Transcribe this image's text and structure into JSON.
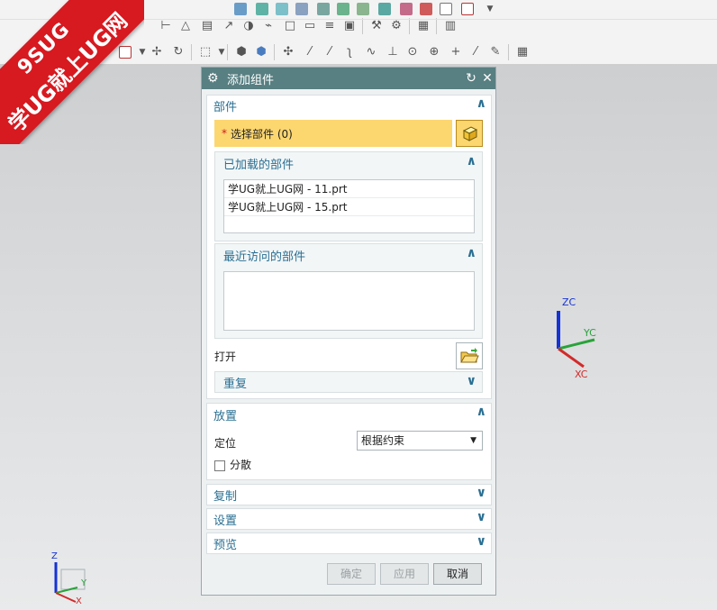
{
  "brand": {
    "line1": "9SUG",
    "line2": "学UG就上UG网"
  },
  "dialog": {
    "title": "添加组件",
    "part_section": {
      "heading": "部件",
      "select_label": "选择部件 (0)",
      "loaded_heading": "已加载的部件",
      "loaded_items": [
        "学UG就上UG网 - 11.prt",
        "学UG就上UG网 - 15.prt"
      ],
      "recent_heading": "最近访问的部件",
      "open_label": "打开",
      "repeat_heading": "重复"
    },
    "placement_section": {
      "heading": "放置",
      "position_label": "定位",
      "position_value": "根据约束",
      "scatter_label": "分散"
    },
    "copy_heading": "复制",
    "settings_heading": "设置",
    "preview_heading": "预览",
    "buttons": {
      "ok": "确定",
      "apply": "应用",
      "cancel": "取消"
    }
  },
  "triad_main": {
    "z": "ZC",
    "y": "YC",
    "x": "XC"
  },
  "triad_small": {
    "z": "Z",
    "y": "Y",
    "x": "X"
  },
  "colors": {
    "header": "#587f82",
    "section": "#2a6f92",
    "highlight": "#fcd66f",
    "brand": "#d71920"
  }
}
